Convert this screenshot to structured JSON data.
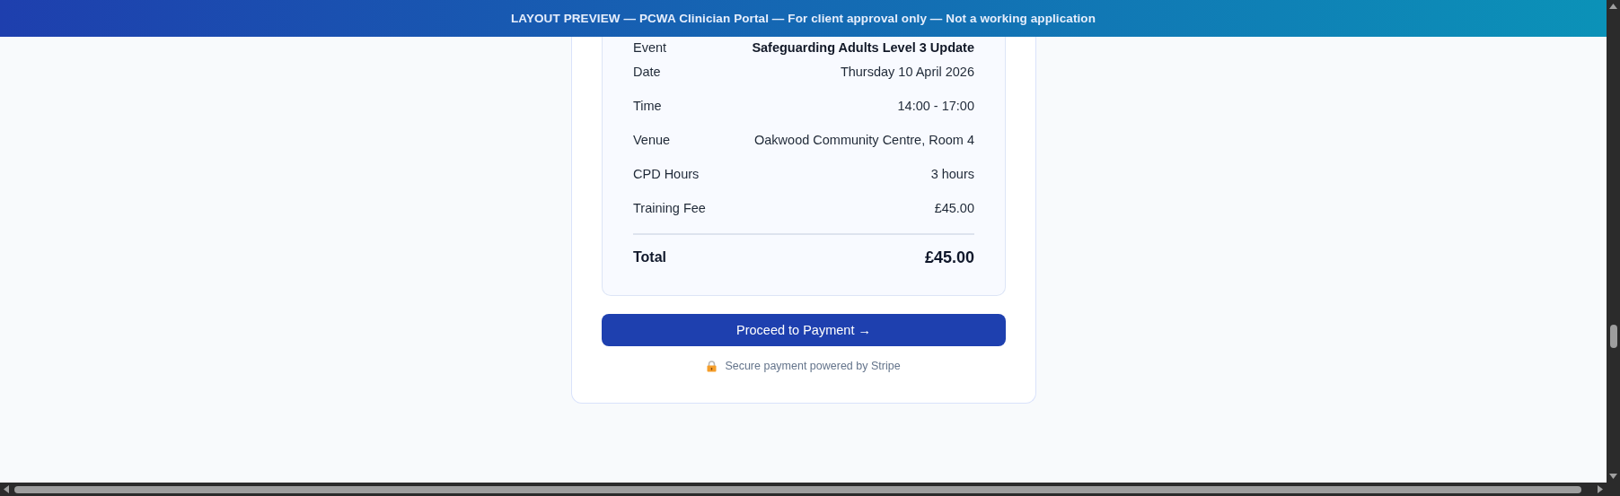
{
  "banner": {
    "text": "LAYOUT PREVIEW — PCWA Clinician Portal — For client approval only — Not a working application"
  },
  "summary": {
    "rows": [
      {
        "label": "Event",
        "value": "Safeguarding Adults Level 3 Update",
        "kind": "bold"
      },
      {
        "label": "Date",
        "value": "Thursday 10 April 2026",
        "kind": "plain"
      },
      {
        "label": "Time",
        "value": "14:00 - 17:00",
        "kind": "plain"
      },
      {
        "label": "Venue",
        "value": "Oakwood Community Centre, Room 4",
        "kind": "plain"
      },
      {
        "label": "CPD Hours",
        "value": "3 hours",
        "kind": "plain"
      },
      {
        "label": "Training Fee",
        "value": "£45.00",
        "kind": "plain"
      }
    ],
    "total": {
      "label": "Total",
      "value": "£45.00"
    }
  },
  "primary_button": {
    "label": "Proceed to Payment →"
  },
  "secure_note": {
    "text": "Secure payment powered by Stripe"
  }
}
